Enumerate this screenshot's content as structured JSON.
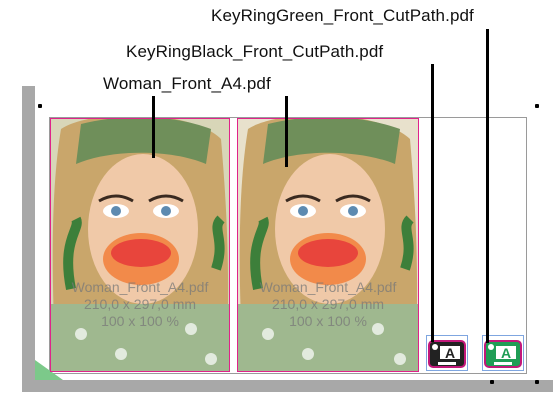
{
  "callouts": {
    "keyring_green": "KeyRingGreen_Front_CutPath.pdf",
    "keyring_black": "KeyRingBlack_Front_CutPath.pdf",
    "woman": "Woman_Front_A4.pdf"
  },
  "tiles": [
    {
      "name": "Woman_Front_A4.pdf",
      "size": "210,0 x 297,0 mm",
      "scale": "100 x 100 %"
    },
    {
      "name": "Woman_Front_A4.pdf",
      "size": "210,0 x 297,0 mm",
      "scale": "100 x 100 %"
    }
  ],
  "keyrings": {
    "black": {
      "label": "A",
      "color": "#222222",
      "border_color": "#c2187a"
    },
    "green": {
      "label": "A",
      "color": "#1f9d55",
      "border_color": "#c2187a"
    }
  },
  "colors": {
    "tile_border": "#e0238a",
    "sheet_border": "#9a9a9a",
    "canvas_shadow": "#a8a8a8",
    "keyring_frame": "#7fa6e0"
  }
}
